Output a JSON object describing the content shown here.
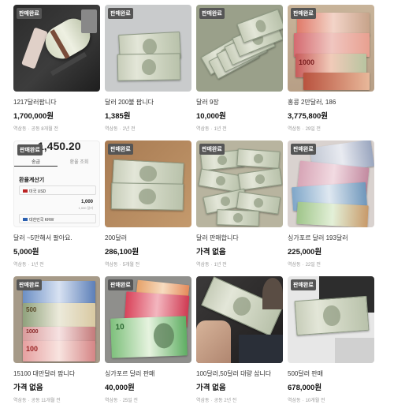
{
  "badge_label": "판매완료",
  "items": [
    {
      "title": "1217달러팝니다",
      "price": "1,700,000원",
      "location": "역삼동",
      "time": "공동 8개월 전"
    },
    {
      "title": "달러 200불 팝니다",
      "price": "1,385원",
      "location": "역삼동",
      "time": "2년 전"
    },
    {
      "title": "달러 9장",
      "price": "10,000원",
      "location": "역삼동",
      "time": "1년 전"
    },
    {
      "title": "홍콩 2만달러, 186",
      "price": "3,775,800원",
      "location": "역삼동",
      "time": "29일 전"
    },
    {
      "title": "달러 ~5만해서 팔아요.",
      "price": "5,000원",
      "location": "역삼동",
      "time": "1년 전"
    },
    {
      "title": "200달러",
      "price": "286,100원",
      "location": "역삼동",
      "time": "5개월 전"
    },
    {
      "title": "달러 판매합니다",
      "price": "가격 없음",
      "location": "역삼동",
      "time": "1년 전"
    },
    {
      "title": "싱가포르 달러 193달러",
      "price": "225,000원",
      "location": "역삼동",
      "time": "22일 전"
    },
    {
      "title": "15100 대만달러 팝니다",
      "price": "가격 없음",
      "location": "역삼동",
      "time": "공동 11개월 전"
    },
    {
      "title": "싱가포르 달러 판매",
      "price": "40,000원",
      "location": "역삼동",
      "time": "25일 전"
    },
    {
      "title": "100달러,50달러 대량 삽니다",
      "price": "가격 없음",
      "location": "역삼동",
      "time": "공동 2년 전"
    },
    {
      "title": "500달러 판매",
      "price": "678,000원",
      "location": "역삼동",
      "time": "10개월 전"
    }
  ],
  "screenshot": {
    "rate_value": "1,450.20",
    "tab_active": "송금",
    "tab_other": "환율 조회",
    "heading": "환율계산기",
    "from_currency": "미국 USD",
    "amount": "1,000",
    "amount_unit": "1,000 달러",
    "to_currency": "대한민국 KRW"
  },
  "bill_labels": {
    "hkd": "1000",
    "twd_1": "500",
    "twd_2": "1000",
    "twd_3": "100",
    "sgd": "10"
  }
}
